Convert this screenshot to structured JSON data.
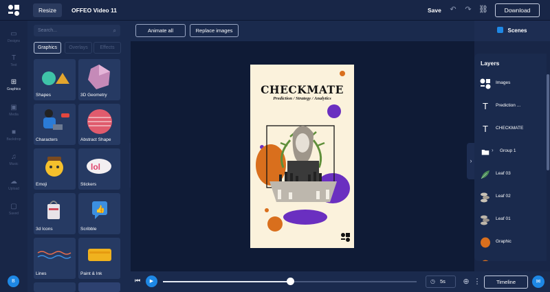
{
  "topbar": {
    "resize_label": "Resize",
    "project_name": "OFFEO Video 11",
    "save_label": "Save",
    "download_label": "Download",
    "icons": [
      "undo-icon",
      "redo-icon",
      "link-icon"
    ]
  },
  "left_rail": {
    "items": [
      {
        "label": "Designs",
        "icon": "▭"
      },
      {
        "label": "Text",
        "icon": "T"
      },
      {
        "label": "Graphics",
        "icon": "⊞"
      },
      {
        "label": "Media",
        "icon": "▣"
      },
      {
        "label": "Backdrop",
        "icon": "■"
      },
      {
        "label": "Music",
        "icon": "♫"
      },
      {
        "label": "Upload",
        "icon": "☁"
      },
      {
        "label": "Saved",
        "icon": "▢"
      }
    ],
    "active": "Graphics",
    "avatar_initial": "B"
  },
  "assets_panel": {
    "search_placeholder": "Search...",
    "tabs": [
      "Graphics",
      "Overlays",
      "Effects"
    ],
    "active_tab": "Graphics",
    "tiles": [
      "Shapes",
      "3D Geometry",
      "Characters",
      "Abstract Shape",
      "Emoji",
      "Stickers",
      "3d Icons",
      "Scribble",
      "Lines",
      "Paint & Ink"
    ]
  },
  "canvas_toolbar": {
    "animate_all": "Animate all",
    "replace_images": "Replace images"
  },
  "poster": {
    "title": "CHECKMATE",
    "subtitle": "Prediction / Strategy / Analytics",
    "accent_orange": "#d96f1d",
    "accent_purple": "#6a2fc0",
    "background": "#fbf2dc"
  },
  "right_panel": {
    "scenes_label": "Scenes",
    "layers_title": "Layers",
    "layers": [
      {
        "label": "Images",
        "icon": "logo"
      },
      {
        "label": "Prediction ...",
        "icon": "text"
      },
      {
        "label": "CHECKMATE",
        "icon": "text"
      },
      {
        "label": "Group 1",
        "icon": "folder"
      },
      {
        "label": "Leaf 03",
        "icon": "leaf"
      },
      {
        "label": "Leaf 02",
        "icon": "leaf"
      },
      {
        "label": "Leaf 01",
        "icon": "leaf"
      },
      {
        "label": "Graphic",
        "icon": "orange-blob"
      }
    ]
  },
  "playback": {
    "duration": "5s",
    "timeline_label": "Timeline",
    "progress": 0.5
  }
}
